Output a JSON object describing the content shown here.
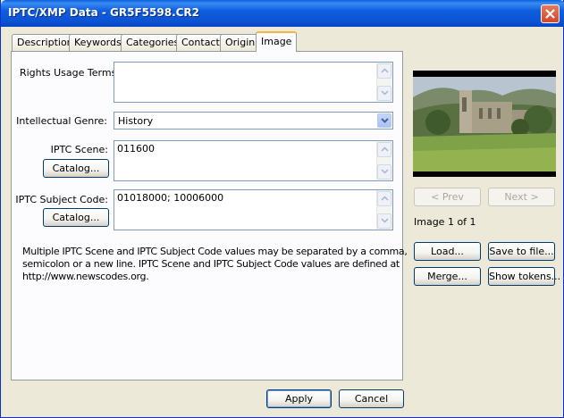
{
  "window": {
    "title": "IPTC/XMP Data - GR5F5598.CR2"
  },
  "tabs": [
    {
      "label": "Description",
      "active": false
    },
    {
      "label": "Keywords",
      "active": false
    },
    {
      "label": "Categories",
      "active": false
    },
    {
      "label": "Contact",
      "active": false
    },
    {
      "label": "Origin",
      "active": false
    },
    {
      "label": "Image",
      "active": true
    }
  ],
  "form": {
    "rights_usage_terms": {
      "label": "Rights Usage Terms:",
      "value": ""
    },
    "intellectual_genre": {
      "label": "Intellectual Genre:",
      "value": "History"
    },
    "iptc_scene": {
      "label": "IPTC Scene:",
      "value": "011600",
      "catalog_label": "Catalog..."
    },
    "iptc_subject_code": {
      "label": "IPTC Subject Code:",
      "value": "01018000; 10006000",
      "catalog_label": "Catalog..."
    },
    "note_lines": [
      "Multiple IPTC Scene and IPTC Subject Code values may be separated by a comma,",
      "semicolon or a new line. IPTC Scene and IPTC Subject Code values are defined at",
      "http://www.newscodes.org."
    ]
  },
  "preview": {
    "prev_label": "< Prev",
    "next_label": "Next >",
    "image_counter": "Image 1 of 1",
    "image_subject": "abbey-ruin-landscape-photo"
  },
  "actions": {
    "load_label": "Load...",
    "save_label": "Save to file...",
    "merge_label": "Merge...",
    "show_tokens_label": "Show tokens...",
    "apply_label": "Apply",
    "cancel_label": "Cancel"
  },
  "colors": {
    "titlebar": "#0b53d1",
    "active_tab_highlight": "#f4b63c",
    "dialog_background": "#ece9d8"
  }
}
